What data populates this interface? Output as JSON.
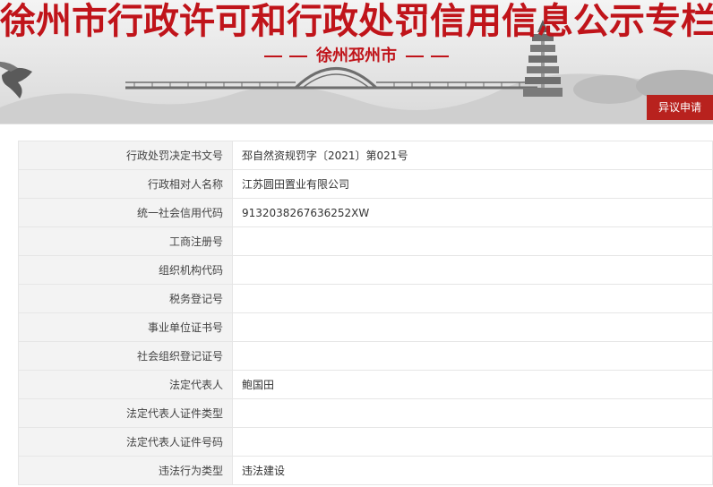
{
  "header": {
    "title": "徐州市行政许可和行政处罚信用信息公示专栏",
    "subtitle": "徐州邳州市",
    "objection_button": "异议申请"
  },
  "records": [
    {
      "label": "行政处罚决定书文号",
      "value": "邳自然资规罚字〔2021〕第021号"
    },
    {
      "label": "行政相对人名称",
      "value": "江苏圆田置业有限公司"
    },
    {
      "label": "统一社会信用代码",
      "value": "913203826763625​2XW"
    },
    {
      "label": "工商注册号",
      "value": ""
    },
    {
      "label": "组织机构代码",
      "value": ""
    },
    {
      "label": "税务登记号",
      "value": ""
    },
    {
      "label": "事业单位证书号",
      "value": ""
    },
    {
      "label": "社会组织登记证号",
      "value": ""
    },
    {
      "label": "法定代表人",
      "value": "鲍国田"
    },
    {
      "label": "法定代表人证件类型",
      "value": ""
    },
    {
      "label": "法定代表人证件号码",
      "value": ""
    },
    {
      "label": "违法行为类型",
      "value": "违法建设"
    }
  ],
  "colors": {
    "brand_red": "#c0141a",
    "button_red": "#b8221e",
    "label_bg": "#f3f3f3",
    "border": "#e6e6e6"
  }
}
